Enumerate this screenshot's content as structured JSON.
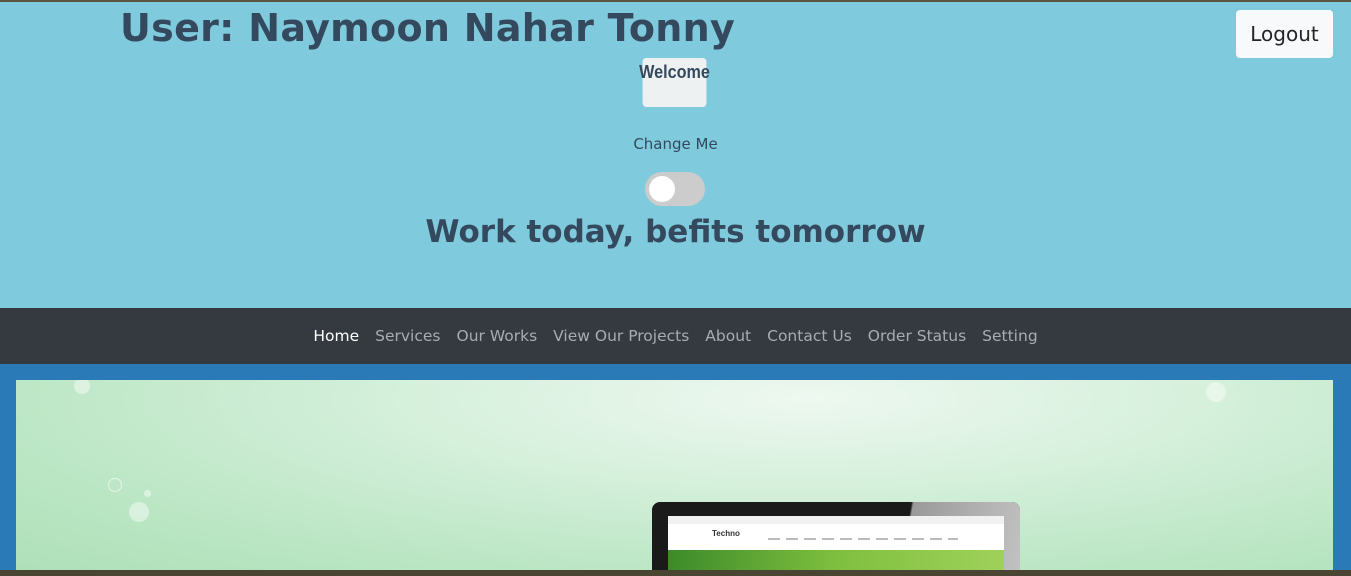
{
  "header": {
    "user_title": "User: Naymoon Nahar Tonny",
    "logout_label": "Logout",
    "welcome_label": "Welcome",
    "change_me_label": "Change Me",
    "toggle_state": "off",
    "slogan": "Work today, befits tomorrow"
  },
  "nav": {
    "items": [
      {
        "label": "Home",
        "active": true
      },
      {
        "label": "Services",
        "active": false
      },
      {
        "label": "Our Works",
        "active": false
      },
      {
        "label": "View Our Projects",
        "active": false
      },
      {
        "label": "About",
        "active": false
      },
      {
        "label": "Contact Us",
        "active": false
      },
      {
        "label": "Order Status",
        "active": false
      },
      {
        "label": "Setting",
        "active": false
      }
    ]
  },
  "banner": {
    "screen_logo_text": "Techno"
  },
  "colors": {
    "header_bg": "#7fcadc",
    "navbar_bg": "#343a40",
    "banner_frame_bg": "#2a7ab8",
    "text_dark": "#34495e"
  }
}
